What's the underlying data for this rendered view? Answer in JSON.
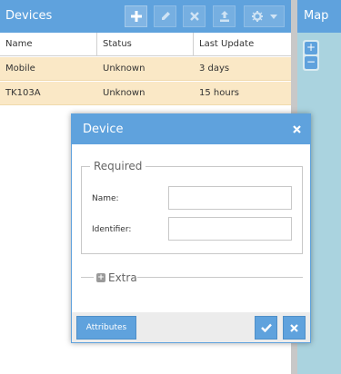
{
  "devices_panel": {
    "title": "Devices",
    "toolbar": {
      "add_icon": "plus-icon",
      "edit_icon": "pencil-icon",
      "remove_icon": "x-icon",
      "command_icon": "upload-icon",
      "settings_icon": "gear-icon",
      "settings_dropdown_icon": "caret-down-icon"
    },
    "columns": [
      "Name",
      "Status",
      "Last Update"
    ],
    "rows": [
      {
        "name": "Mobile",
        "status": "Unknown",
        "last_update": "3 days"
      },
      {
        "name": "TK103A",
        "status": "Unknown",
        "last_update": "15 hours"
      }
    ],
    "selected_row_color": "#fae8c6"
  },
  "map_panel": {
    "title": "Map",
    "zoom_in": "+",
    "zoom_out": "−"
  },
  "dialog": {
    "title": "Device",
    "required_legend": "Required",
    "name_label": "Name:",
    "name_value": "",
    "identifier_label": "Identifier:",
    "identifier_value": "",
    "extra_legend": "Extra",
    "extra_toggle": "+",
    "attributes_button": "Attributes",
    "save_icon": "checkmark-icon",
    "cancel_icon": "x-icon"
  },
  "colors": {
    "accent": "#5fa2dd",
    "map_water": "#aad3df",
    "footer_bg": "#ececec"
  }
}
